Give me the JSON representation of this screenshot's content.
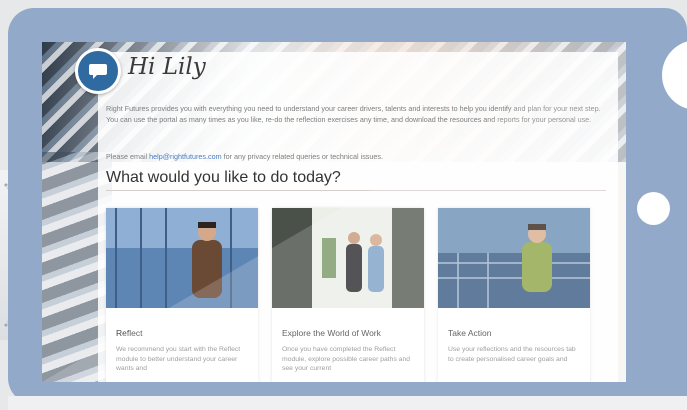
{
  "page": {
    "greeting": "Hi Lily",
    "intro": "Right Futures provides you with everything you need to understand your career drivers, talents and interests to help you identify and plan for your next step. You can use the portal as many times as you like, re-do the reflection exercises any time, and download the resources and reports for your personal use.",
    "email_prefix": "Please email",
    "email_link": "help@rightfutures.com",
    "email_suffix": "for any privacy related queries or technical issues.",
    "heading": "What would you like to do today?"
  },
  "cards": [
    {
      "title": "Reflect",
      "description": "We recommend you start with the Reflect module to better understand your career wants and"
    },
    {
      "title": "Explore the World of Work",
      "description": "Once you have completed the Reflect module, explore possible career paths and see your current"
    },
    {
      "title": "Take Action",
      "description": "Use your reflections and the resources tab to create personalised career goals and"
    }
  ],
  "colors": {
    "frame": "#93a9c9",
    "accent": "#2f6aa0",
    "link": "#4a7cc0"
  }
}
